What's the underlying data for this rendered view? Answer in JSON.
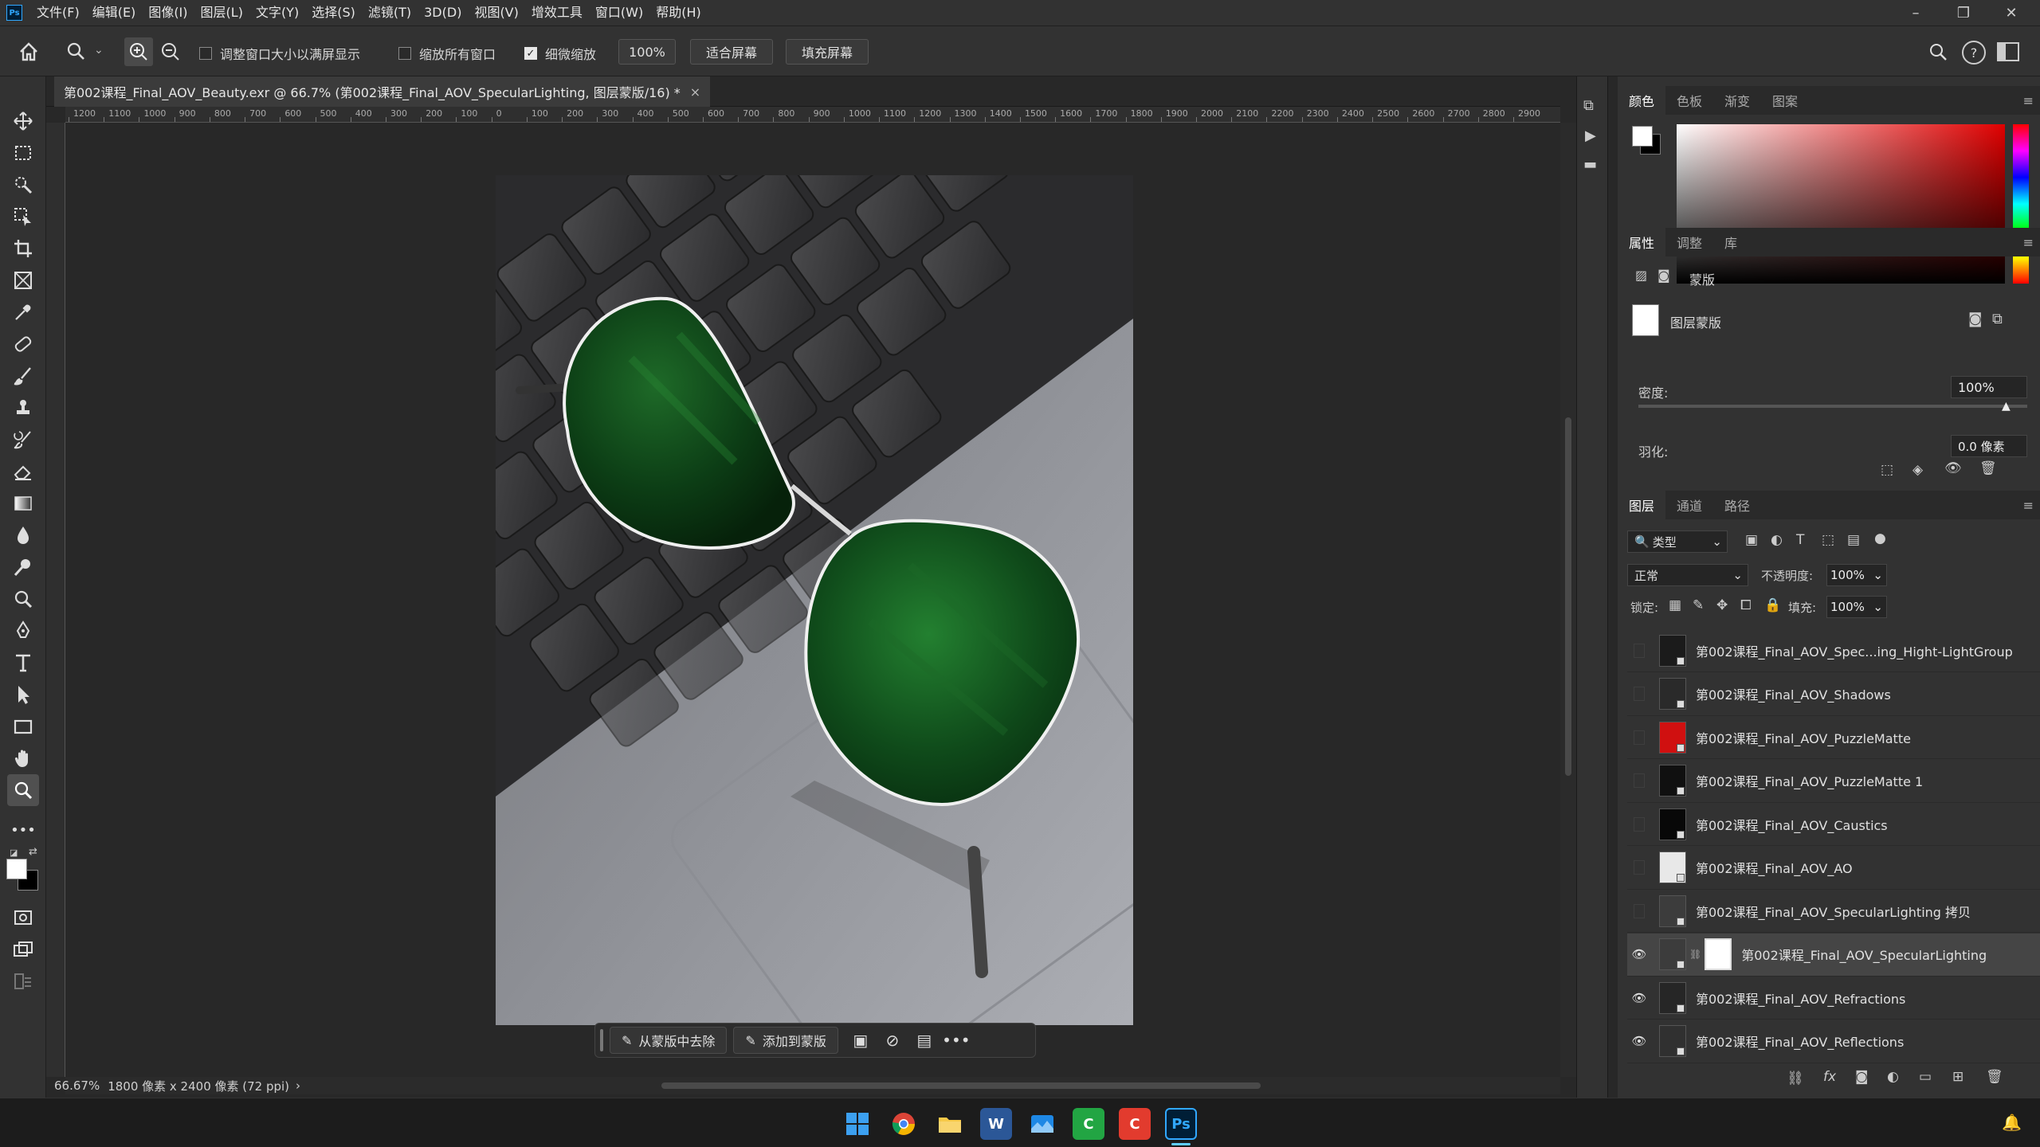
{
  "app": {
    "logo": "Ps"
  },
  "menubar": {
    "items": [
      "文件(F)",
      "编辑(E)",
      "图像(I)",
      "图层(L)",
      "文字(Y)",
      "选择(S)",
      "滤镜(T)",
      "3D(D)",
      "视图(V)",
      "增效工具",
      "窗口(W)",
      "帮助(H)"
    ]
  },
  "optionsbar": {
    "resize_windows_label": "调整窗口大小以满屏显示",
    "resize_windows_checked": false,
    "zoom_all_label": "缩放所有窗口",
    "zoom_all_checked": false,
    "scrubby_zoom_label": "细微缩放",
    "scrubby_zoom_checked": true,
    "zoom_value": "100%",
    "fit_screen_label": "适合屏幕",
    "fill_screen_label": "填充屏幕"
  },
  "document": {
    "tab_title": "第002课程_Final_AOV_Beauty.exr @ 66.7% (第002课程_Final_AOV_SpecularLighting, 图层蒙版/16) *",
    "close_glyph": "×",
    "ruler_labels": [
      "1200",
      "1100",
      "1000",
      "900",
      "800",
      "700",
      "600",
      "500",
      "400",
      "300",
      "200",
      "100",
      "0",
      "100",
      "200",
      "300",
      "400",
      "500",
      "600",
      "700",
      "800",
      "900",
      "1000",
      "1100",
      "1200",
      "1300",
      "1400",
      "1500",
      "1600",
      "1700",
      "1800",
      "1900",
      "2000",
      "2100",
      "2200",
      "2300",
      "2400",
      "2500",
      "2600",
      "2700",
      "2800",
      "2900"
    ]
  },
  "contextbar": {
    "remove_from_mask_label": "从蒙版中去除",
    "add_to_mask_label": "添加到蒙版",
    "more_glyph": "•••"
  },
  "status": {
    "zoom": "66.67%",
    "info": "1800 像素 x 2400 像素 (72 ppi)",
    "arrow": "›"
  },
  "color_panel": {
    "tabs": [
      "颜色",
      "色板",
      "渐变",
      "图案"
    ],
    "foreground": "#ffffff",
    "background": "#000000",
    "picker_hue": "#e00000"
  },
  "properties_panel": {
    "tabs": [
      "属性",
      "调整",
      "库"
    ],
    "mask_section_label": "蒙版",
    "layer_mask_label": "图层蒙版",
    "density_label": "密度:",
    "density_value": "100%",
    "feather_label": "羽化:",
    "feather_value": "0.0 像素"
  },
  "layers_panel": {
    "tabs": [
      "图层",
      "通道",
      "路径"
    ],
    "filter_label": "类型",
    "blend_mode": "正常",
    "opacity_label": "不透明度:",
    "opacity_value": "100%",
    "lock_label": "锁定:",
    "fill_label": "填充:",
    "fill_value": "100%",
    "layers": [
      {
        "name": "第002课程_Final_AOV_Spec...ing_Hight-LightGroup",
        "visible": false,
        "thumb": "#1b1b1b",
        "selected": false
      },
      {
        "name": "第002课程_Final_AOV_Shadows",
        "visible": false,
        "thumb": "#2a2a2a",
        "selected": false
      },
      {
        "name": "第002课程_Final_AOV_PuzzleMatte",
        "visible": false,
        "thumb": "#d01010",
        "selected": false
      },
      {
        "name": "第002课程_Final_AOV_PuzzleMatte 1",
        "visible": false,
        "thumb": "#101010",
        "selected": false
      },
      {
        "name": "第002课程_Final_AOV_Caustics",
        "visible": false,
        "thumb": "#080808",
        "selected": false
      },
      {
        "name": "第002课程_Final_AOV_AO",
        "visible": false,
        "thumb": "#e8e8e8",
        "selected": false
      },
      {
        "name": "第002课程_Final_AOV_SpecularLighting 拷贝",
        "visible": false,
        "thumb": "#3c3c3c",
        "selected": false
      },
      {
        "name": "第002课程_Final_AOV_SpecularLighting",
        "visible": true,
        "thumb": "#3c3c3c",
        "selected": true
      },
      {
        "name": "第002课程_Final_AOV_Refractions",
        "visible": true,
        "thumb": "#262626",
        "selected": false
      },
      {
        "name": "第002课程_Final_AOV_Reflections",
        "visible": true,
        "thumb": "#303030",
        "selected": false
      }
    ]
  },
  "taskbar": {
    "apps": [
      "windows-start",
      "chrome",
      "file-explorer",
      "word",
      "photos",
      "app-green",
      "app-red",
      "photoshop"
    ],
    "ps_label": "Ps"
  },
  "icons": {
    "eye": "👁"
  }
}
